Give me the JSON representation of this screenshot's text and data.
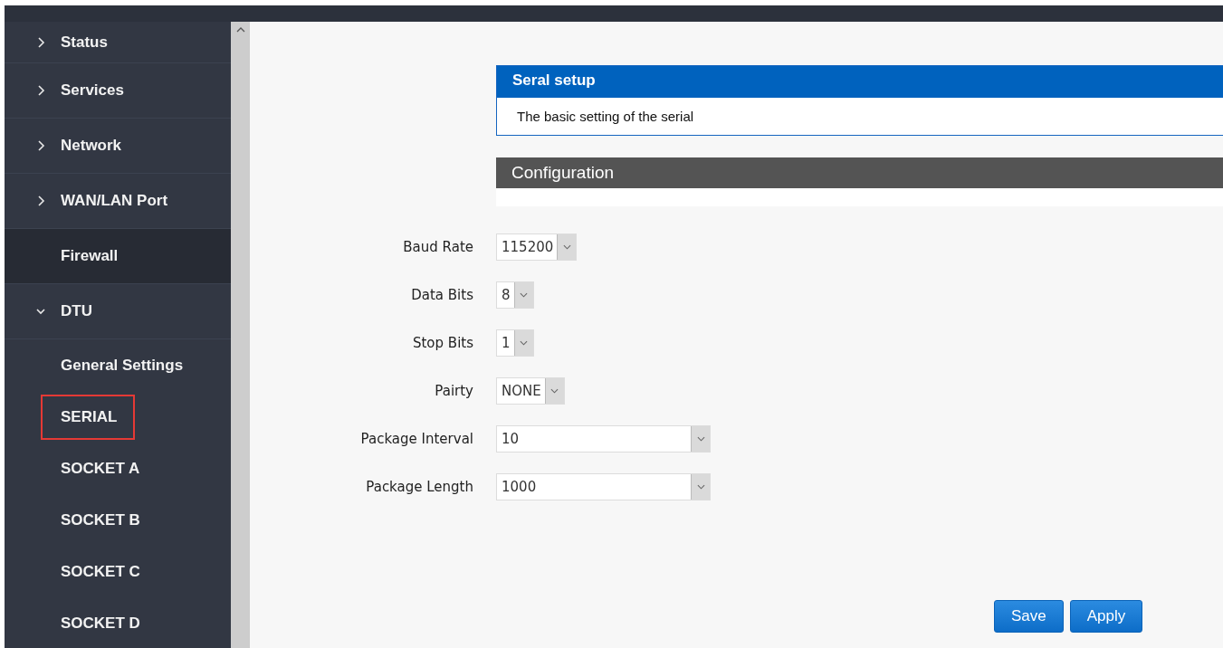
{
  "sidebar": {
    "items": [
      {
        "label": "Status",
        "expanded": false,
        "selected": false,
        "outlined": false
      },
      {
        "label": "Services",
        "expanded": false,
        "selected": false,
        "outlined": false
      },
      {
        "label": "Network",
        "expanded": false,
        "selected": false,
        "outlined": false
      },
      {
        "label": "WAN/LAN Port",
        "expanded": false,
        "selected": false,
        "outlined": false
      },
      {
        "label": "Firewall",
        "selected": true,
        "outlined": false
      },
      {
        "label": "DTU",
        "expanded": true,
        "selected": false,
        "outlined": false,
        "children": [
          {
            "label": "General Settings",
            "selected": false,
            "outlined": false
          },
          {
            "label": "SERIAL",
            "selected": false,
            "outlined": true
          },
          {
            "label": "SOCKET A",
            "selected": false,
            "outlined": false
          },
          {
            "label": "SOCKET B",
            "selected": false,
            "outlined": false
          },
          {
            "label": "SOCKET C",
            "selected": false,
            "outlined": false
          },
          {
            "label": "SOCKET D",
            "selected": false,
            "outlined": false
          }
        ]
      }
    ]
  },
  "setup_card": {
    "title": "Seral setup",
    "description": "The basic setting of the serial"
  },
  "configuration": {
    "title": "Configuration",
    "fields": [
      {
        "label": "Baud Rate",
        "value": "115200",
        "kind": "compact"
      },
      {
        "label": "Data Bits",
        "value": "8",
        "kind": "compact"
      },
      {
        "label": "Stop Bits",
        "value": "1",
        "kind": "compact"
      },
      {
        "label": "Pairty",
        "value": "NONE",
        "kind": "compact"
      },
      {
        "label": "Package Interval",
        "value": "10",
        "kind": "wide"
      },
      {
        "label": "Package Length",
        "value": "1000",
        "kind": "wide"
      }
    ]
  },
  "buttons": [
    "Save",
    "Apply"
  ]
}
